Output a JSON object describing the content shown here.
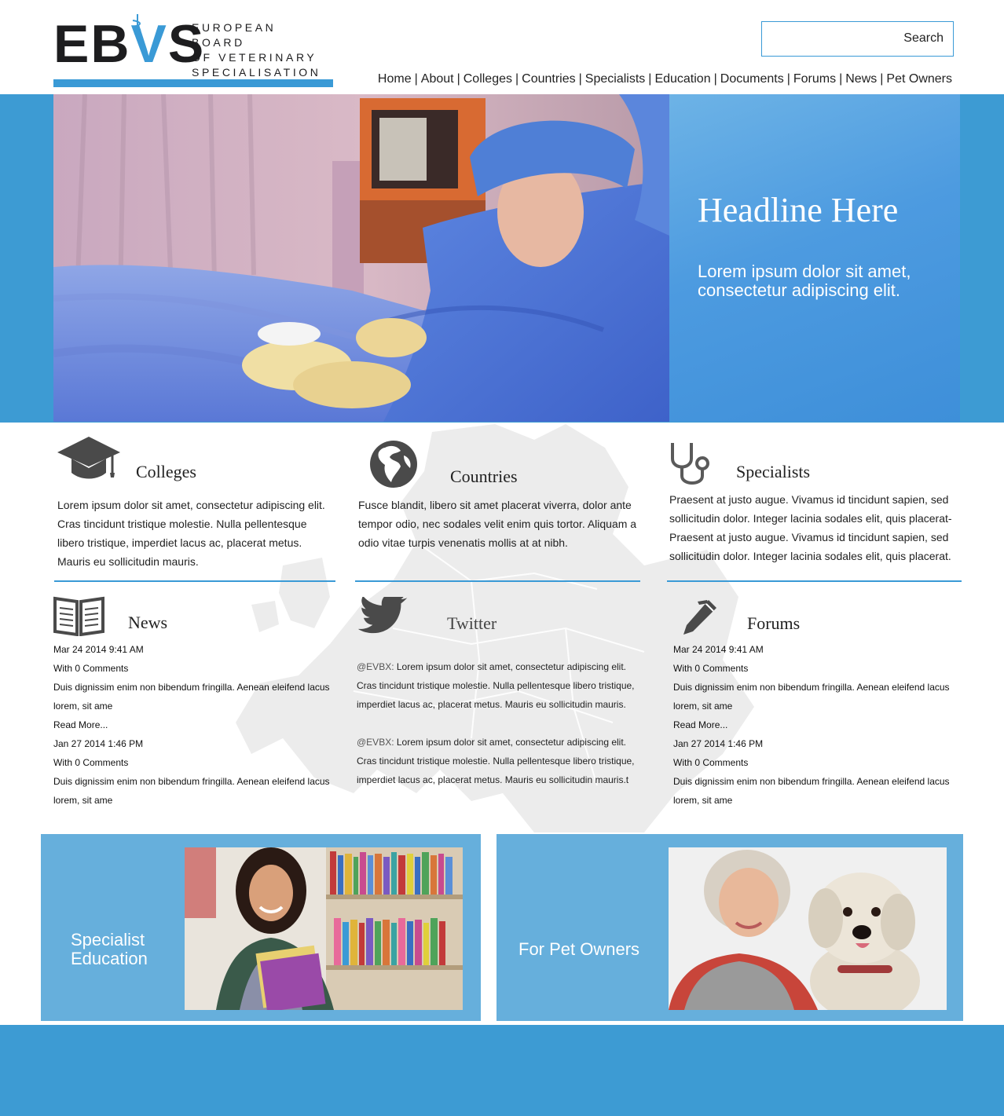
{
  "brand": {
    "letters_a": "EB",
    "letters_v": "V",
    "letters_b": "S",
    "tagline": [
      "EUROPEAN BOARD",
      "OF VETERINARY",
      "SPECIALISATION"
    ],
    "accent_color": "#3a9ad6"
  },
  "search": {
    "button_label": "Search",
    "placeholder": ""
  },
  "nav": {
    "items": [
      "Home",
      "About",
      "Colleges",
      "Countries",
      "Specialists",
      "Education",
      "Documents",
      "Forums",
      "News",
      "Pet Owners"
    ]
  },
  "hero": {
    "title": "Headline Here",
    "subtitle": "Lorem ipsum dolor sit amet, consectetur adipiscing elit."
  },
  "features": {
    "colleges": {
      "title": "Colleges",
      "icon": "graduation-cap-icon",
      "body": "Lorem ipsum dolor sit amet, consectetur adipiscing elit. Cras tincidunt tristique molestie. Nulla pellentesque libero tristique, imperdiet lacus ac, placerat metus. Mauris eu sollicitudin mauris."
    },
    "countries": {
      "title": "Countries",
      "icon": "globe-icon",
      "body": "Fusce blandit, libero sit amet placerat viverra, dolor ante tempor odio, nec sodales velit enim quis tortor. Aliquam a odio vitae turpis venenatis mollis at at nibh."
    },
    "specialists": {
      "title": "Specialists",
      "icon": "stethoscope-icon",
      "body": "Praesent at justo augue. Vivamus id tincidunt sapien, sed sollicitudin dolor. Integer lacinia sodales elit, quis placerat- Praesent at justo augue. Vivamus id tincidunt sapien, sed sollicitudin dolor. Integer lacinia sodales elit, quis placerat."
    }
  },
  "news": {
    "title": "News",
    "icon": "book-icon",
    "posts": [
      {
        "date": "Mar 24 2014 9:41 AM",
        "comments": "With 0 Comments",
        "excerpt": "Duis dignissim enim non bibendum fringilla. Aenean eleifend lacus lorem, sit ame",
        "more": "Read More..."
      },
      {
        "date": "Jan 27 2014 1:46 PM",
        "comments": "With 0 Comments",
        "excerpt": "Duis dignissim enim non bibendum fringilla. Aenean eleifend lacus lorem, sit ame"
      }
    ]
  },
  "twitter": {
    "title": "Twitter",
    "icon": "twitter-bird-icon",
    "tweets": [
      {
        "handle": "@EVBX:",
        "text": " Lorem ipsum dolor sit amet, consectetur adipiscing elit. Cras tincidunt tristique molestie. Nulla pellentesque libero tristique, imperdiet lacus ac, placerat metus. Mauris eu sollicitudin mauris."
      },
      {
        "handle": "@EVBX:",
        "text": " Lorem ipsum dolor sit amet, consectetur adipiscing elit. Cras tincidunt tristique molestie. Nulla pellentesque libero tristique, imperdiet lacus ac, placerat metus. Mauris eu sollicitudin mauris.t"
      }
    ]
  },
  "forums": {
    "title": "Forums",
    "icon": "pen-icon",
    "posts": [
      {
        "date": "Mar 24 2014 9:41 AM",
        "comments": "With 0 Comments",
        "excerpt": "Duis dignissim enim non bibendum fringilla. Aenean eleifend lacus lorem, sit ame",
        "more": "Read More..."
      },
      {
        "date": "Jan 27 2014 1:46 PM",
        "comments": "With 0 Comments",
        "excerpt": "Duis dignissim enim non bibendum fringilla. Aenean eleifend lacus lorem, sit ame"
      }
    ]
  },
  "promos": {
    "education": {
      "label": "Specialist Education"
    },
    "pet_owners": {
      "label": "For Pet Owners"
    }
  }
}
